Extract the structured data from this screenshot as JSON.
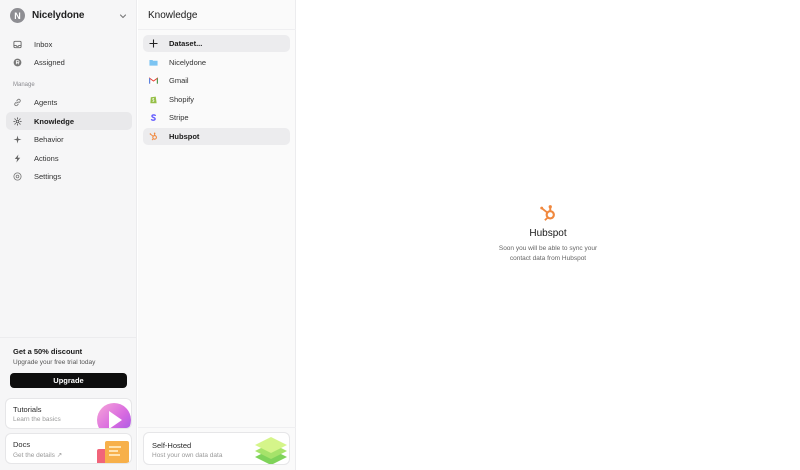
{
  "workspace": {
    "initial": "N",
    "name": "Nicelydone"
  },
  "nav_top": [
    {
      "label": "Inbox",
      "icon": "inbox-icon"
    },
    {
      "label": "Assigned",
      "icon": "assigned-icon"
    }
  ],
  "manage_label": "Manage",
  "nav_manage": [
    {
      "label": "Agents",
      "icon": "link-icon",
      "active": false
    },
    {
      "label": "Knowledge",
      "icon": "gear-icon",
      "active": true
    },
    {
      "label": "Behavior",
      "icon": "sparkle-icon",
      "active": false
    },
    {
      "label": "Actions",
      "icon": "bolt-icon",
      "active": false
    },
    {
      "label": "Settings",
      "icon": "settings-icon",
      "active": false
    }
  ],
  "promo": {
    "title": "Get a 50% discount",
    "subtitle": "Upgrade your free trial today",
    "button": "Upgrade"
  },
  "cards": {
    "tutorials": {
      "title": "Tutorials",
      "subtitle": "Learn the basics"
    },
    "docs": {
      "title": "Docs",
      "subtitle": "Get the details ↗"
    }
  },
  "knowledge": {
    "title": "Knowledge",
    "items": [
      {
        "label": "Dataset...",
        "icon": "plus-icon"
      },
      {
        "label": "Nicelydone",
        "icon": "folder-icon"
      },
      {
        "label": "Gmail",
        "icon": "gmail-icon"
      },
      {
        "label": "Shopify",
        "icon": "shopify-icon"
      },
      {
        "label": "Stripe",
        "icon": "stripe-icon"
      },
      {
        "label": "Hubspot",
        "icon": "hubspot-icon"
      }
    ],
    "selfhosted": {
      "title": "Self-Hosted",
      "subtitle": "Host your own data data"
    }
  },
  "detail": {
    "title": "Hubspot",
    "description": "Soon you will be able to sync your contact data from Hubspot",
    "icon": "hubspot-icon"
  },
  "colors": {
    "hubspot": "#f0883e",
    "accent_dark": "#0e0e0e",
    "sidebar_bg": "#f6f6f7"
  }
}
